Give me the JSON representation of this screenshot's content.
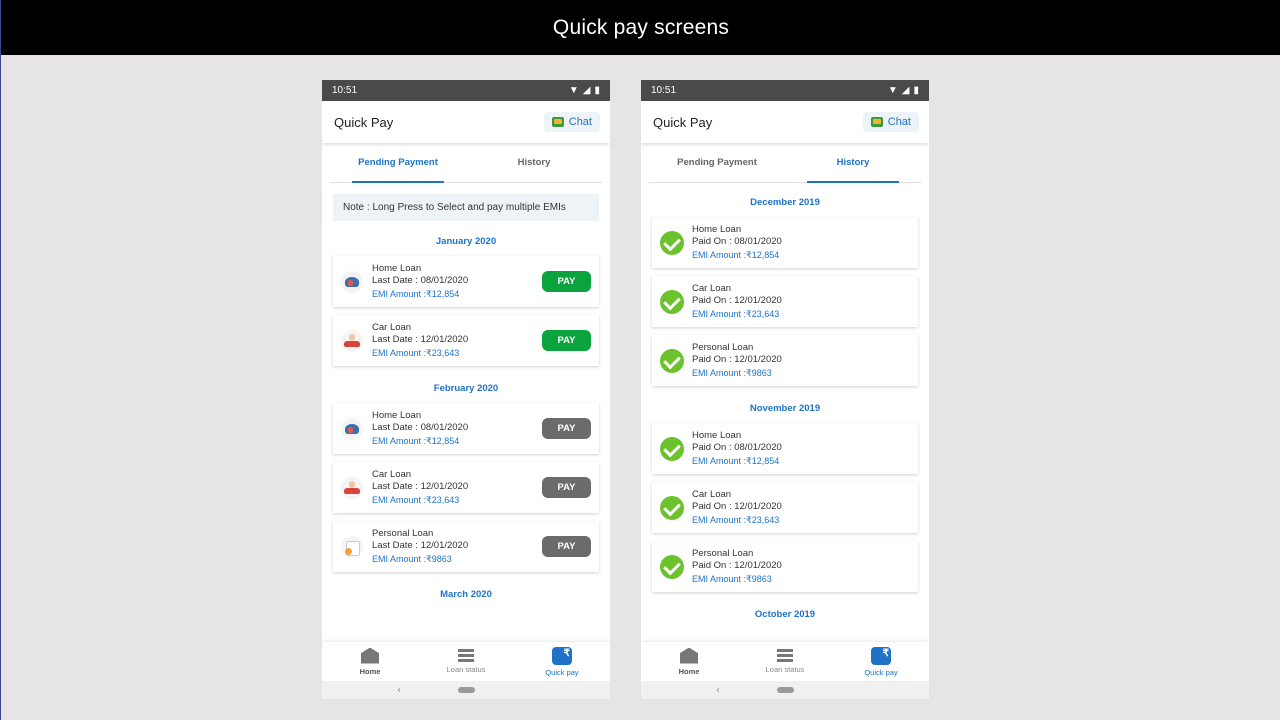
{
  "slide_title": "Quick pay screens",
  "phones": [
    {
      "status_time": "10:51",
      "title": "Quick Pay",
      "chat_label": "Chat",
      "tabs": [
        "Pending Payment",
        "History"
      ],
      "note": "Note : Long Press to Select and pay multiple EMIs",
      "sections": [
        {
          "month": "January 2020",
          "items": [
            {
              "name": "Home Loan",
              "date": "Last Date : 08/01/2020",
              "amount": "EMI Amount :₹12,854",
              "pay": "PAY"
            },
            {
              "name": "Car Loan",
              "date": "Last Date : 12/01/2020",
              "amount": "EMI Amount :₹23,643",
              "pay": "PAY"
            }
          ]
        },
        {
          "month": "February 2020",
          "items": [
            {
              "name": "Home Loan",
              "date": "Last Date : 08/01/2020",
              "amount": "EMI Amount :₹12,854",
              "pay": "PAY"
            },
            {
              "name": "Car Loan",
              "date": "Last Date : 12/01/2020",
              "amount": "EMI Amount :₹23,643",
              "pay": "PAY"
            },
            {
              "name": "Personal Loan",
              "date": "Last Date : 12/01/2020",
              "amount": "EMI Amount :₹9863",
              "pay": "PAY"
            }
          ]
        },
        {
          "month": "March 2020",
          "items": []
        }
      ]
    },
    {
      "status_time": "10:51",
      "title": "Quick Pay",
      "chat_label": "Chat",
      "tabs": [
        "Pending Payment",
        "History"
      ],
      "sections": [
        {
          "month": "December 2019",
          "items": [
            {
              "name": "Home Loan",
              "date": "Paid On : 08/01/2020",
              "amount": "EMI Amount :₹12,854"
            },
            {
              "name": "Car Loan",
              "date": "Paid On : 12/01/2020",
              "amount": "EMI Amount :₹23,643"
            },
            {
              "name": "Personal Loan",
              "date": "Paid On : 12/01/2020",
              "amount": "EMI Amount :₹9863"
            }
          ]
        },
        {
          "month": "November 2019",
          "items": [
            {
              "name": "Home Loan",
              "date": "Paid On : 08/01/2020",
              "amount": "EMI Amount :₹12,854"
            },
            {
              "name": "Car Loan",
              "date": "Paid On : 12/01/2020",
              "amount": "EMI Amount :₹23,643"
            },
            {
              "name": "Personal Loan",
              "date": "Paid On : 12/01/2020",
              "amount": "EMI Amount :₹9863"
            }
          ]
        },
        {
          "month": "October 2019",
          "items": []
        }
      ]
    }
  ],
  "bottom_nav": [
    "Home",
    "Loan status",
    "Quick pay"
  ],
  "colors": {
    "accent": "#1e73c7",
    "pay_active": "#0aa33d",
    "pay_inactive": "#6b6b6b",
    "check": "#6cc22c"
  }
}
